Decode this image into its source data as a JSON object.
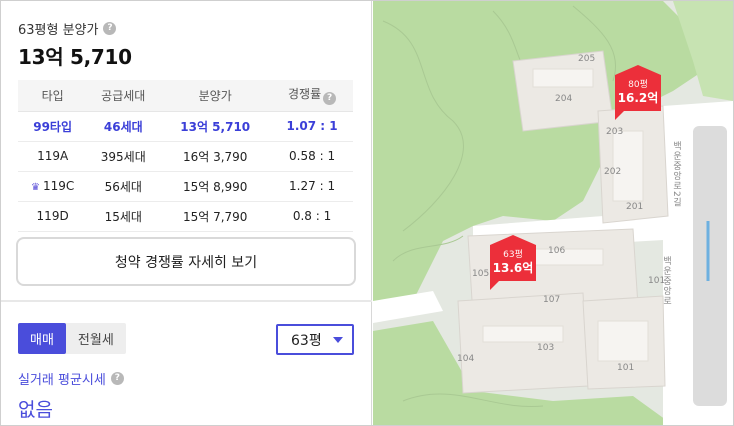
{
  "summary": {
    "title": "63평형 분양가",
    "help_icon": "?",
    "price": "13억 5,710"
  },
  "supply_table": {
    "headers": [
      "타입",
      "공급세대",
      "분양가",
      "경쟁률"
    ],
    "rows": [
      {
        "type": "99타입",
        "households": "46세대",
        "price": "13억 5,710",
        "ratio": "1.07 : 1",
        "highlight": true
      },
      {
        "type": "119A",
        "households": "395세대",
        "price": "16억 3,790",
        "ratio": "0.58 : 1",
        "highlight": false
      },
      {
        "type": "119C",
        "households": "56세대",
        "price": "15억 8,990",
        "ratio": "1.27 : 1",
        "highlight": false,
        "icon": "crown-icon"
      },
      {
        "type": "119D",
        "households": "15세대",
        "price": "15억 7,790",
        "ratio": "0.8 : 1",
        "highlight": false
      }
    ]
  },
  "detail_button": "청약 경쟁률 자세히 보기",
  "trade_tabs": [
    {
      "label": "매매",
      "active": true
    },
    {
      "label": "전월세",
      "active": false
    }
  ],
  "size_select": {
    "value": "63평"
  },
  "avg_price": {
    "title": "실거래 평균시세",
    "value": "없음"
  },
  "map": {
    "markers": [
      {
        "size": "80평",
        "price": "16.2억"
      },
      {
        "size": "63평",
        "price": "13.6억"
      }
    ],
    "buildings": [
      "205",
      "204",
      "203",
      "202",
      "201",
      "106",
      "105",
      "107",
      "101",
      "104",
      "103",
      "101"
    ],
    "roads": [
      "백운중앙로2길",
      "백운중앙로"
    ]
  },
  "colors": {
    "accent": "#4a4ddb",
    "marker": "#ec2f3a",
    "map_green": "#b9dba1",
    "map_block": "#ece9e4"
  }
}
